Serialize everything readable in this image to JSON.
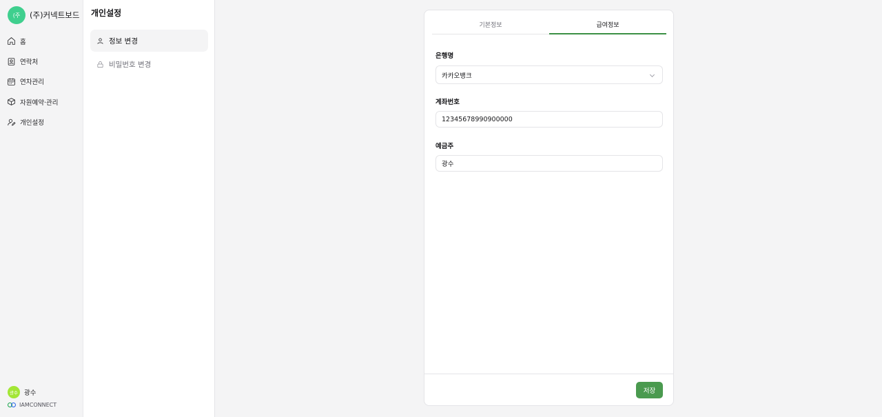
{
  "brand": {
    "logo_text": "(주",
    "name": "(주)커넥트보드",
    "color": "#3fcf8e"
  },
  "nav": {
    "items": [
      {
        "label": "홈",
        "icon": "home-icon"
      },
      {
        "label": "연락처",
        "icon": "contact-card-icon"
      },
      {
        "label": "연차관리",
        "icon": "calendar-icon"
      },
      {
        "label": "자원예약·관리",
        "icon": "box-icon"
      },
      {
        "label": "개인설정",
        "icon": "user-edit-icon"
      }
    ]
  },
  "user": {
    "avatar_text": "광수",
    "name": "광수"
  },
  "footer": {
    "brand": "IAMCONNECT"
  },
  "settings": {
    "title": "개인설정",
    "items": [
      {
        "label": "정보 변경",
        "icon": "user-icon",
        "active": true
      },
      {
        "label": "비밀번호 변경",
        "icon": "lock-icon",
        "active": false
      }
    ]
  },
  "tabs": [
    {
      "label": "기본정보",
      "active": false
    },
    {
      "label": "급여정보",
      "active": true
    }
  ],
  "form": {
    "bank_label": "은행명",
    "bank_value": "카카오뱅크",
    "account_label": "계좌번호",
    "account_value": "12345678990900000",
    "holder_label": "예금주",
    "holder_value": "광수"
  },
  "actions": {
    "save_label": "저장"
  },
  "colors": {
    "accent": "#4a9a4f",
    "tab_underline": "#3a8f44"
  }
}
